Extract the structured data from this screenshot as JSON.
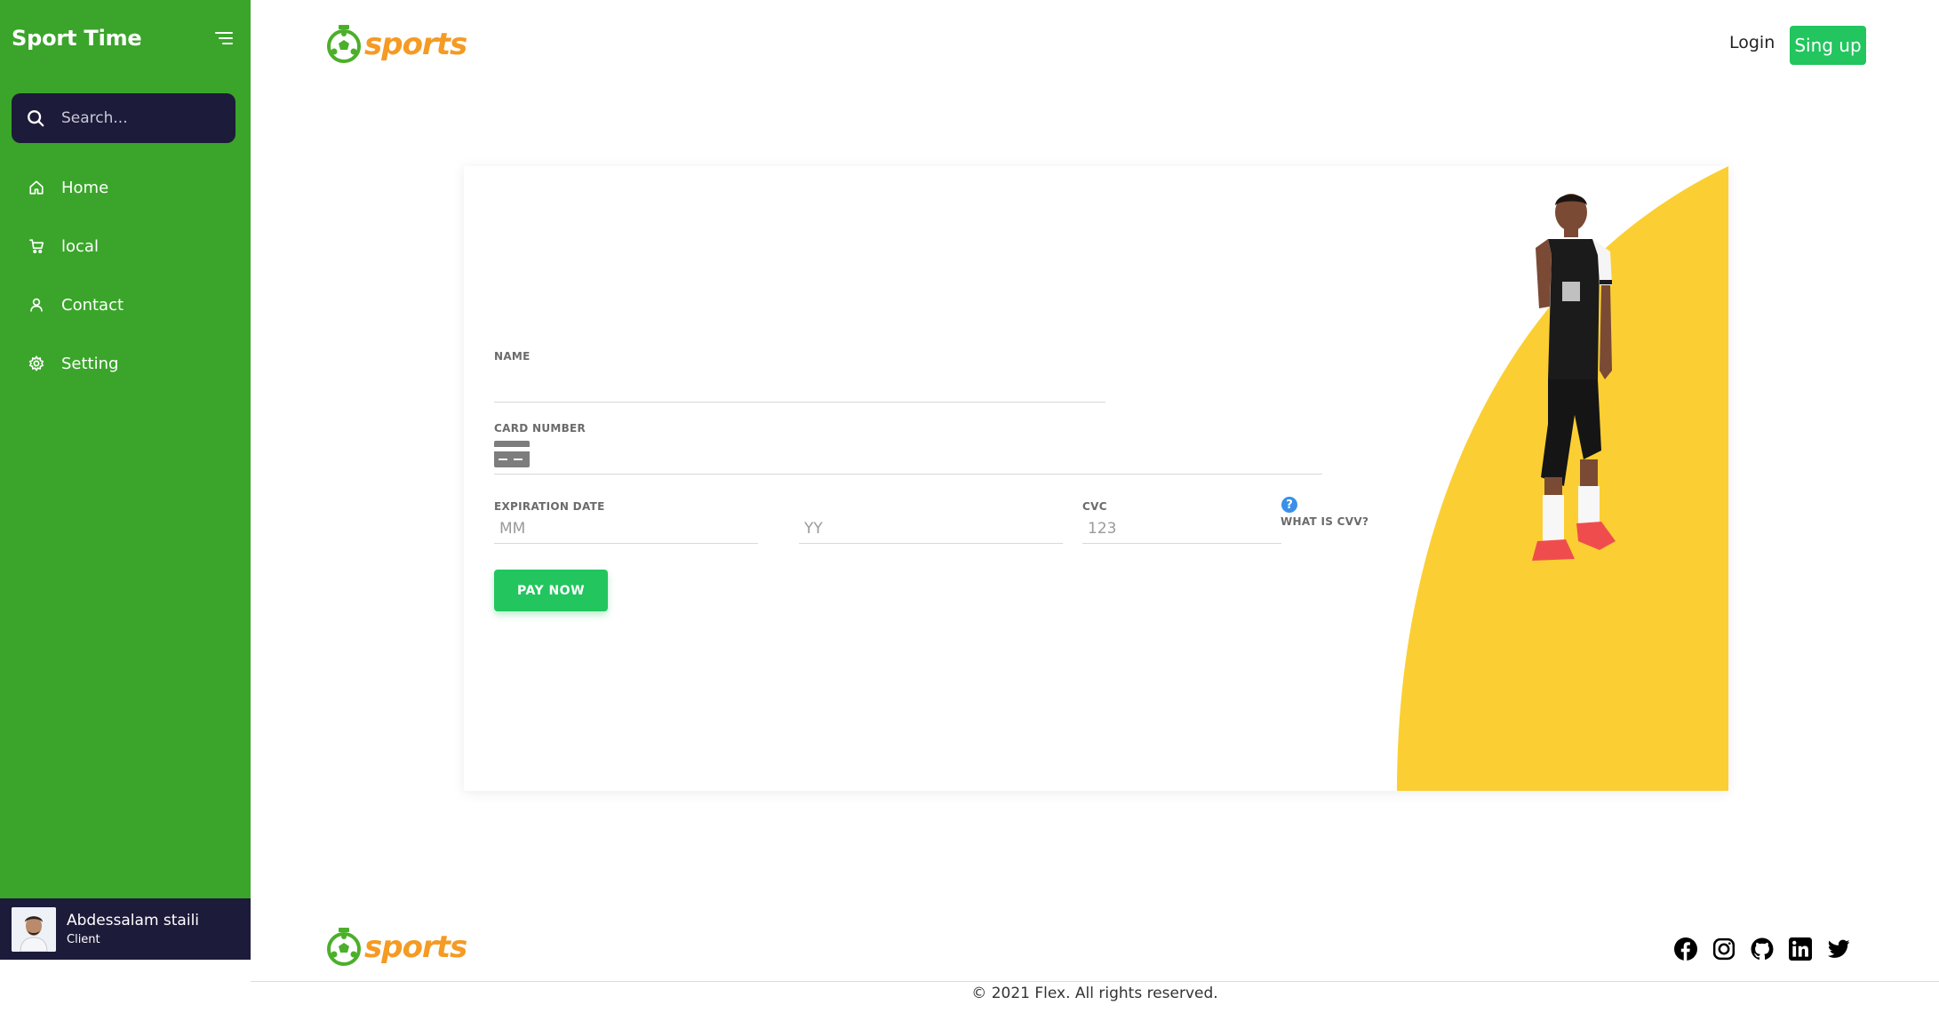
{
  "sidebar": {
    "title": "Sport Time",
    "search_placeholder": "Search...",
    "items": [
      {
        "label": "Home",
        "icon": "home-icon"
      },
      {
        "label": "local",
        "icon": "cart-icon"
      },
      {
        "label": "Contact",
        "icon": "user-icon"
      },
      {
        "label": "Setting",
        "icon": "gear-icon"
      }
    ],
    "user": {
      "name": "Abdessalam staili",
      "role": "Client"
    }
  },
  "header": {
    "logo_text": "sports",
    "login_label": "Login",
    "signup_label": "Sing up"
  },
  "payment_form": {
    "name_label": "NAME",
    "name_value": "",
    "card_number_label": "CARD NUMBER",
    "card_number_value": "",
    "expiration_label": "EXPIRATION DATE",
    "month_placeholder": "MM",
    "year_placeholder": "YY",
    "cvc_label": "CVC",
    "cvc_placeholder": "123",
    "help_glyph": "?",
    "what_is_cvv_label": "WHAT IS CVV?",
    "pay_button_label": "PAY NOW"
  },
  "footer": {
    "logo_text": "sports",
    "social_icons": [
      "facebook-icon",
      "instagram-icon",
      "github-icon",
      "linkedin-icon",
      "twitter-icon"
    ],
    "copyright": "© 2021 Flex. All rights reserved."
  },
  "colors": {
    "sidebar_bg": "#3aa52a",
    "dark_navy": "#1d1b3a",
    "accent_green": "#22c55e",
    "logo_orange": "#f59a23",
    "yellow_panel": "#fbcf33"
  }
}
